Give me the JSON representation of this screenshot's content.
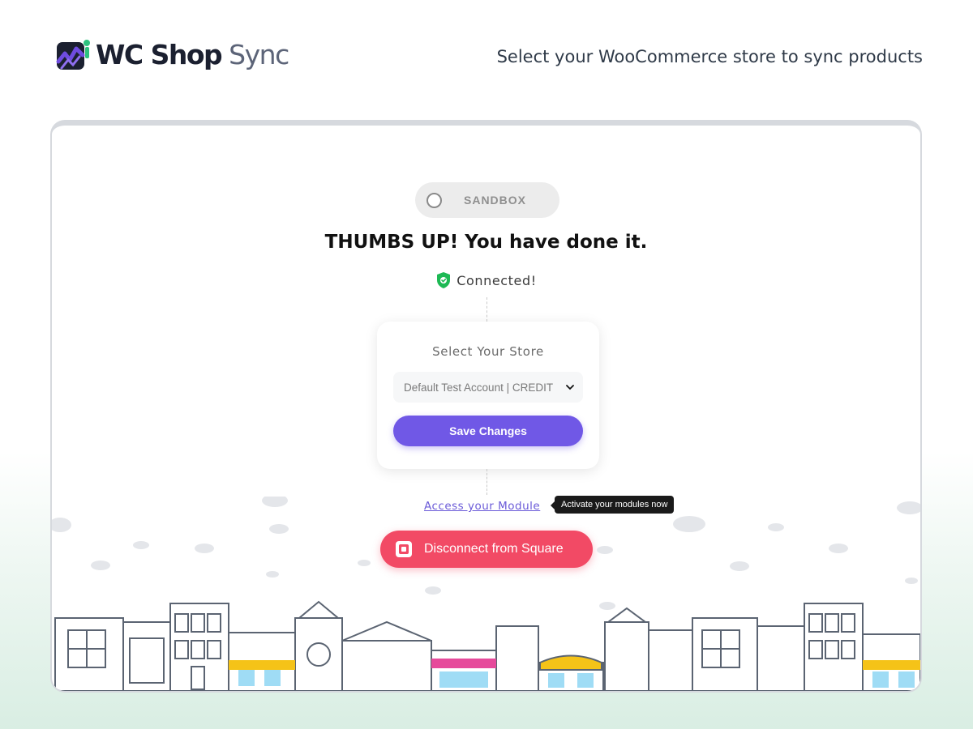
{
  "header": {
    "brand_primary": "WC Shop",
    "brand_secondary": "Sync",
    "tagline": "Select your WooCommerce store to sync products"
  },
  "sandbox": {
    "label": "SANDBOX",
    "enabled": false
  },
  "status": {
    "headline": "THUMBS UP! You have done it.",
    "connected_label": "Connected!"
  },
  "store_selector": {
    "title": "Select Your Store",
    "selected_value": "Default Test Account | CREDIT",
    "save_label": "Save Changes"
  },
  "module_link": {
    "label": "Access your Module",
    "tooltip": "Activate your modules now"
  },
  "disconnect": {
    "label": "Disconnect from Square"
  },
  "colors": {
    "accent_purple": "#7058e6",
    "danger_red": "#f24a65",
    "success_green": "#1db954"
  }
}
